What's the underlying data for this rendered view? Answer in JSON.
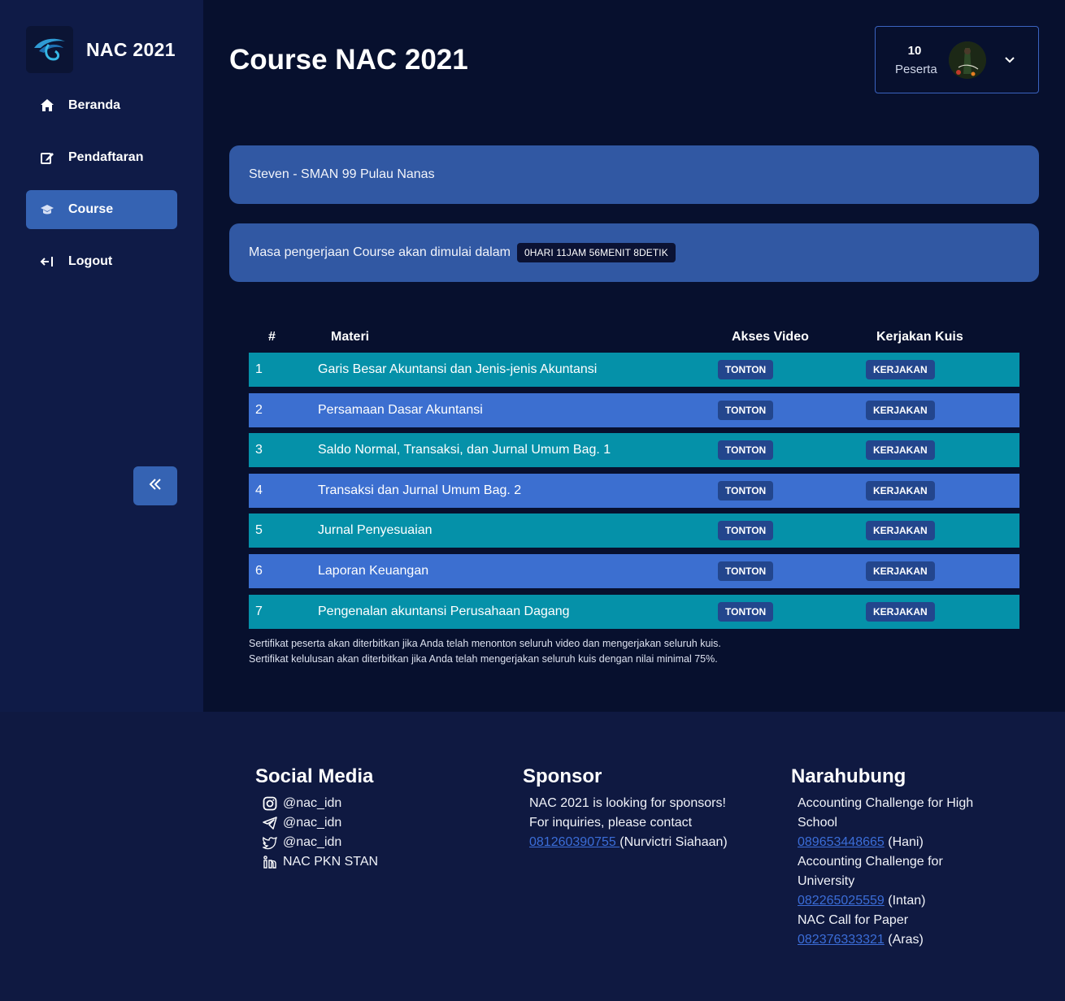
{
  "brand": {
    "name": "NAC 2021"
  },
  "nav": [
    {
      "label": "Beranda",
      "icon": "home-icon"
    },
    {
      "label": "Pendaftaran",
      "icon": "edit-icon"
    },
    {
      "label": "Course",
      "icon": "graduation-cap-icon",
      "active": true
    },
    {
      "label": "Logout",
      "icon": "logout-icon"
    }
  ],
  "page": {
    "title": "Course NAC 2021"
  },
  "profile": {
    "count": "10",
    "label": "Peserta"
  },
  "info": {
    "participant": "Steven - SMAN 99 Pulau Nanas",
    "countdown_text": "Masa pengerjaan Course akan dimulai dalam",
    "countdown_value": "0HARI 11JAM 56MENIT 8DETIK"
  },
  "table": {
    "headers": {
      "num": "#",
      "materi": "Materi",
      "video": "Akses Video",
      "kuis": "Kerjakan Kuis"
    },
    "video_btn": "TONTON",
    "kuis_btn": "KERJAKAN",
    "rows": [
      {
        "num": "1",
        "materi": "Garis Besar Akuntansi dan Jenis-jenis Akuntansi"
      },
      {
        "num": "2",
        "materi": "Persamaan Dasar Akuntansi"
      },
      {
        "num": "3",
        "materi": "Saldo Normal, Transaksi, dan Jurnal Umum Bag. 1"
      },
      {
        "num": "4",
        "materi": "Transaksi dan Jurnal Umum Bag. 2"
      },
      {
        "num": "5",
        "materi": "Jurnal Penyesuaian"
      },
      {
        "num": "6",
        "materi": "Laporan Keuangan"
      },
      {
        "num": "7",
        "materi": "Pengenalan akuntansi Perusahaan Dagang"
      }
    ]
  },
  "notes": [
    "Sertifikat peserta akan diterbitkan jika Anda telah menonton seluruh video dan mengerjakan seluruh kuis.",
    "Sertifikat kelulusan akan diterbitkan jika Anda telah mengerjakan seluruh kuis dengan nilai minimal 75%."
  ],
  "footer": {
    "social": {
      "title": "Social Media",
      "items": [
        {
          "label": "@nac_idn",
          "icon": "instagram-icon"
        },
        {
          "label": "@nac_idn",
          "icon": "telegram-icon"
        },
        {
          "label": "@nac_idn",
          "icon": "twitter-icon"
        },
        {
          "label": "NAC PKN STAN",
          "icon": "linkedin-icon"
        }
      ]
    },
    "sponsor": {
      "title": "Sponsor",
      "line1": "NAC 2021 is looking for sponsors!",
      "line2": "For inquiries, please contact",
      "phone": "081260390755 ",
      "name": "(Nurvictri Siahaan)"
    },
    "contact": {
      "title": "Narahubung",
      "items": [
        {
          "label": "Accounting Challenge for High School",
          "phone": "089653448665",
          "name": "(Hani)"
        },
        {
          "label": "Accounting Challenge for University",
          "phone": "082265025559",
          "name": "(Intan)"
        },
        {
          "label": "NAC Call for Paper",
          "phone": "082376333321",
          "name": "(Aras)"
        }
      ]
    }
  },
  "colors": {
    "accent": "#3563b3",
    "row_teal": "#0591a9",
    "row_blue": "#3c6fd0",
    "link": "#3b6dd8"
  }
}
